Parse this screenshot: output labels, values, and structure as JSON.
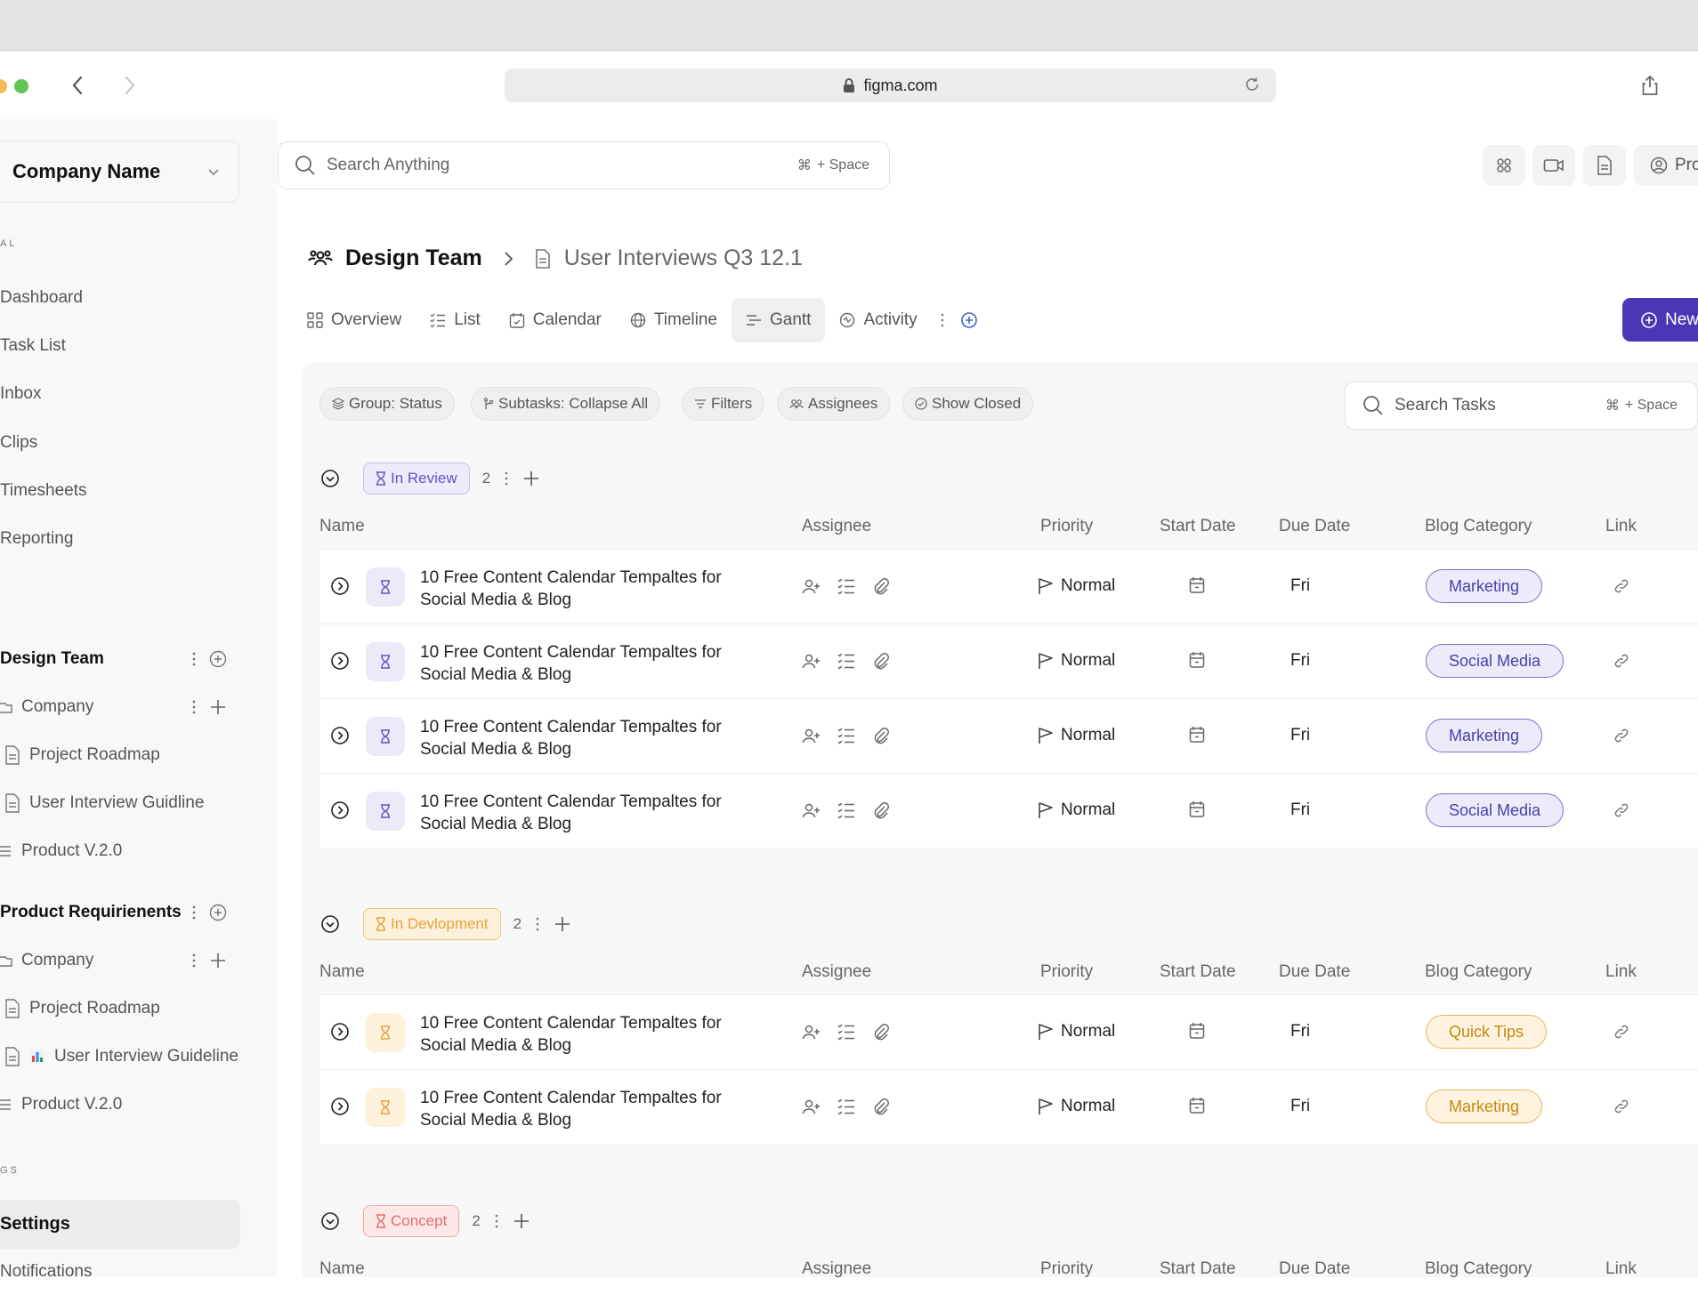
{
  "browser": {
    "url": "figma.com"
  },
  "sidebar": {
    "company": "Company Name",
    "section_general": "AL",
    "nav": [
      "Dashboard",
      "Task List",
      "Inbox",
      "Clips",
      "Timesheets",
      "Reporting"
    ],
    "team1": {
      "name": "Design Team",
      "folder": "Company",
      "docs": [
        "Project Roadmap",
        "User Interview Guidline"
      ],
      "list": "Product V.2.0"
    },
    "team2": {
      "name": "Product Requirienents",
      "folder": "Company",
      "docs": [
        "Project Roadmap",
        "User Interview Guideline"
      ],
      "list": "Product V.2.0"
    },
    "section_settings": "GS",
    "settings": "Settings",
    "notifications": "Notifications"
  },
  "topbar": {
    "search_placeholder": "Search Anything",
    "search_shortcut_symbol": "⌘",
    "search_shortcut": "+ Space",
    "profile_label": "Pro"
  },
  "breadcrumb": {
    "team": "Design Team",
    "doc": "User Interviews Q3 12.1"
  },
  "tabs": [
    "Overview",
    "List",
    "Calendar",
    "Timeline",
    "Gantt",
    "Activity"
  ],
  "active_tab": "Gantt",
  "new_button": "New",
  "toolbar": {
    "chips": [
      "Group: Status",
      "Subtasks: Collapse All",
      "Filters",
      "Assignees",
      "Show Closed"
    ],
    "task_search_placeholder": "Search Tasks",
    "task_search_shortcut_symbol": "⌘",
    "task_search_shortcut": "+ Space"
  },
  "columns": [
    "Name",
    "Assignee",
    "Priority",
    "Start Date",
    "Due Date",
    "Blog Category",
    "Link"
  ],
  "groups": [
    {
      "status": "In Review",
      "count": "2",
      "color": "#6655c4",
      "tasks": [
        {
          "name": "10 Free Content Calendar Tempaltes for Social Media & Blog",
          "priority": "Normal",
          "due": "Fri",
          "category": "Marketing"
        },
        {
          "name": "10 Free Content Calendar Tempaltes for Social Media & Blog",
          "priority": "Normal",
          "due": "Fri",
          "category": "Social Media"
        },
        {
          "name": "10 Free Content Calendar Tempaltes for Social Media & Blog",
          "priority": "Normal",
          "due": "Fri",
          "category": "Marketing"
        },
        {
          "name": "10 Free Content Calendar Tempaltes for Social Media & Blog",
          "priority": "Normal",
          "due": "Fri",
          "category": "Social Media"
        }
      ]
    },
    {
      "status": "In Devlopment",
      "count": "2",
      "color": "#e6a23c",
      "tasks": [
        {
          "name": "10 Free Content Calendar Tempaltes for Social Media & Blog",
          "priority": "Normal",
          "due": "Fri",
          "category": "Quick Tips"
        },
        {
          "name": "10 Free Content Calendar Tempaltes for Social Media & Blog",
          "priority": "Normal",
          "due": "Fri",
          "category": "Marketing"
        }
      ]
    },
    {
      "status": "Concept",
      "count": "2",
      "color": "#e86b6b",
      "tasks": []
    }
  ]
}
